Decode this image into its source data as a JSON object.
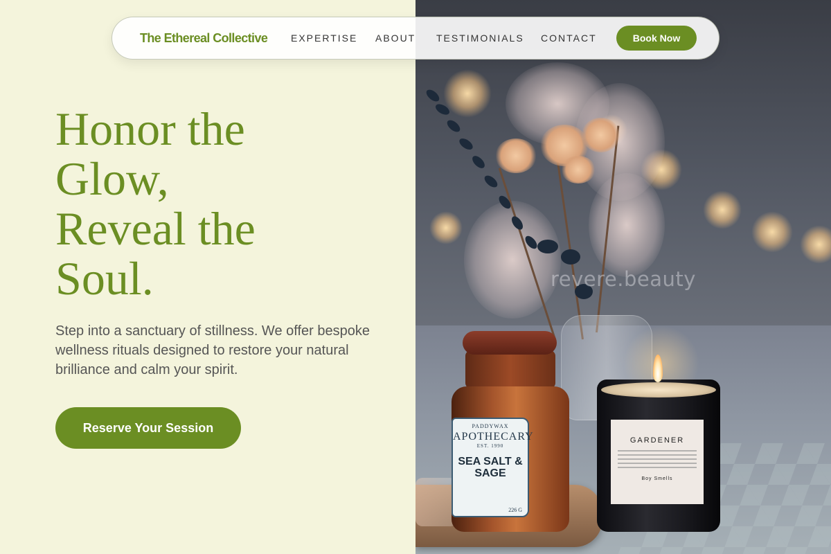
{
  "nav": {
    "logo": "The Ethereal Collective",
    "links": [
      "EXPERTISE",
      "ABOUT",
      "TESTIMONIALS",
      "CONTACT"
    ],
    "cta": "Book Now"
  },
  "hero": {
    "title_lines": [
      "Honor the",
      "Glow,",
      "Reveal the",
      "Soul."
    ],
    "subtitle": "Step into a sanctuary of stillness. We offer bespoke wellness rituals designed to restore your natural brilliance and calm your spirit.",
    "cta": "Reserve Your Session"
  },
  "image": {
    "watermark": "revere.beauty",
    "jar_label": {
      "brand": "PADDYWAX",
      "name": "APOTHECARY",
      "est": "EST. 1990",
      "scent": "SEA SALT & SAGE",
      "weight": "226 G"
    },
    "candle_label": {
      "name": "GARDENER",
      "brand": "Boy Smells"
    }
  },
  "colors": {
    "accent": "#6b8e23",
    "background": "#f4f4dc",
    "nav_bg": "#ffffff"
  }
}
